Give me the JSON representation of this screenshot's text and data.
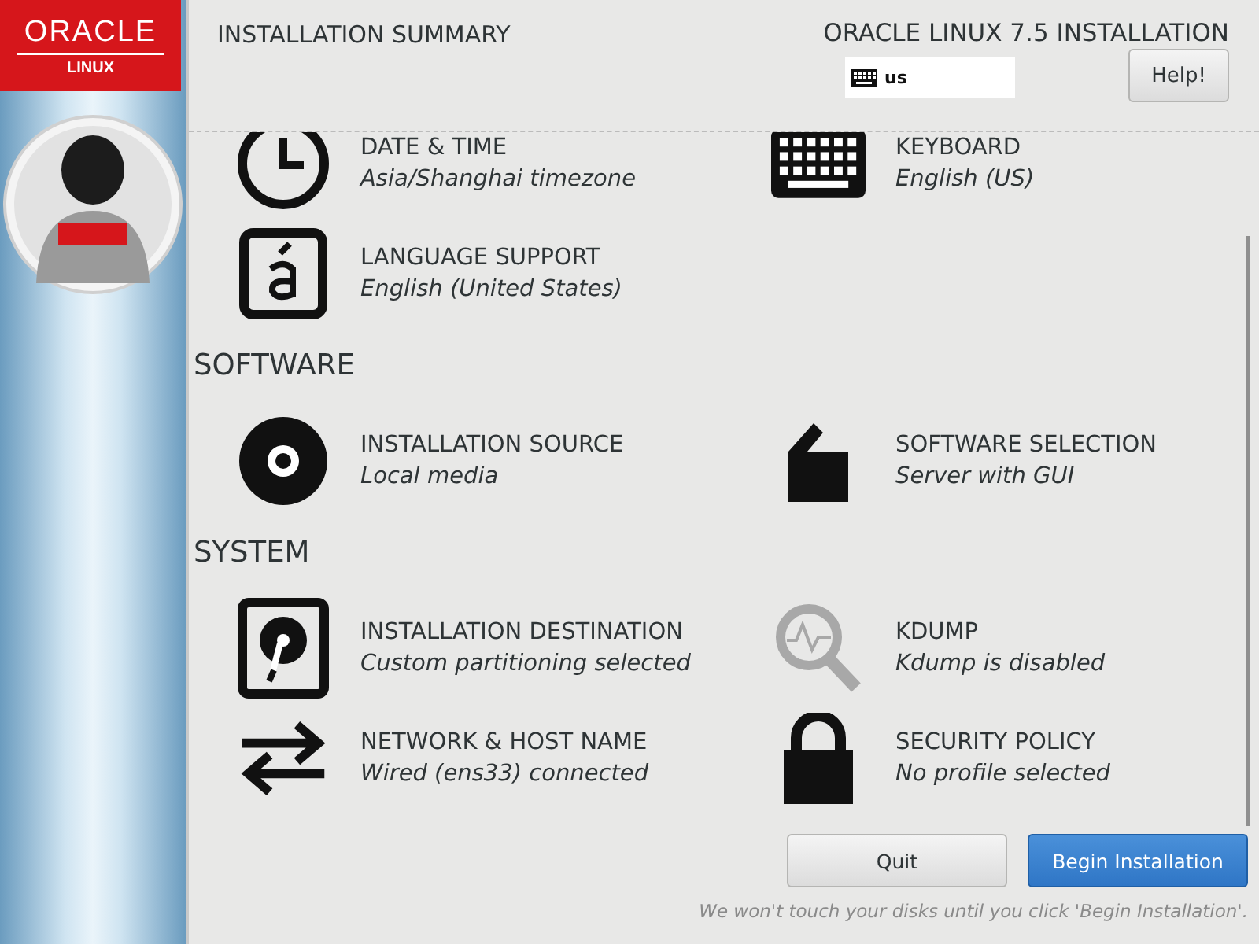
{
  "sidebar": {
    "logo": {
      "brand": "ORACLE",
      "product": "LINUX"
    }
  },
  "header": {
    "title": "INSTALLATION SUMMARY",
    "product_title": "ORACLE LINUX 7.5 INSTALLATION",
    "keyboard_layout": "us",
    "help_button": "Help!"
  },
  "sections": [
    {
      "items": [
        {
          "title": "DATE & TIME",
          "status": "Asia/Shanghai timezone"
        },
        {
          "title": "KEYBOARD",
          "status": "English (US)"
        },
        {
          "title": "LANGUAGE SUPPORT",
          "status": "English (United States)"
        }
      ]
    },
    {
      "title": "SOFTWARE",
      "items": [
        {
          "title": "INSTALLATION SOURCE",
          "status": "Local media"
        },
        {
          "title": "SOFTWARE SELECTION",
          "status": "Server with GUI"
        }
      ]
    },
    {
      "title": "SYSTEM",
      "items": [
        {
          "title": "INSTALLATION DESTINATION",
          "status": "Custom partitioning selected"
        },
        {
          "title": "KDUMP",
          "status": "Kdump is disabled"
        },
        {
          "title": "NETWORK & HOST NAME",
          "status": "Wired (ens33) connected"
        },
        {
          "title": "SECURITY POLICY",
          "status": "No profile selected"
        }
      ]
    }
  ],
  "buttons": [
    {
      "label": "Quit",
      "kind": "secondary"
    },
    {
      "label": "Begin Installation",
      "kind": "primary"
    }
  ],
  "footer_note": "We won't touch your disks until you click 'Begin Installation'."
}
